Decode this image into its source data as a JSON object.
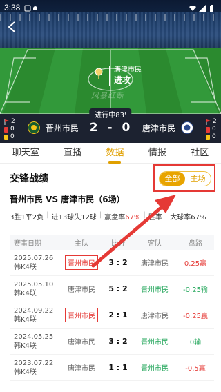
{
  "status_bar": {
    "time": "3:38"
  },
  "event": {
    "team": "唐津市民",
    "action": "进攻"
  },
  "watermark": "风暴红断",
  "scorebar": {
    "match_status": "进行中83'",
    "home": {
      "name": "晋州市民",
      "corners": "2",
      "red_cards": "0",
      "yellow_cards": "0"
    },
    "away": {
      "name": "唐津市民",
      "corners": "2",
      "red_cards": "0",
      "yellow_cards": "0"
    },
    "score_home": "2",
    "score_dash": "-",
    "score_away": "0"
  },
  "tabs": [
    {
      "label": "聊天室",
      "active": false
    },
    {
      "label": "直播",
      "active": false
    },
    {
      "label": "数据",
      "active": true
    },
    {
      "label": "情报",
      "active": false
    },
    {
      "label": "社区",
      "active": false
    }
  ],
  "section": {
    "title": "交锋战绩",
    "toggle_all": "全部",
    "toggle_home": "主场",
    "vs_title": "晋州市民 VS 唐津市民（6场）",
    "summary": {
      "record": "3胜1平2负",
      "goals": "进13球失12球",
      "win_rate_label": "赢盘率",
      "win_rate_value": "67%",
      "victory_label": "胜率",
      "victory_value": "",
      "big_ball": "大球率67%"
    }
  },
  "table": {
    "headers": {
      "date": "赛事日期",
      "home": "主队",
      "score": "比分",
      "away": "客队",
      "odds": "盘路"
    },
    "rows": [
      {
        "date": "2025.07.26",
        "league": "韩K4联",
        "home": "晋州市民",
        "score": "3 : 2",
        "away": "唐津市民",
        "odds": "0.25赢",
        "home_color": "red",
        "away_color": "grey",
        "odds_color": "red"
      },
      {
        "date": "2025.05.10",
        "league": "韩K4联",
        "home": "唐津市民",
        "score": "5 : 2",
        "away": "晋州市民",
        "odds": "-0.25输",
        "home_color": "grey",
        "away_color": "green",
        "odds_color": "green"
      },
      {
        "date": "2024.09.22",
        "league": "韩K4联",
        "home": "晋州市民",
        "score": "2 : 1",
        "away": "唐津市民",
        "odds": "-0.25赢",
        "home_color": "red",
        "away_color": "grey",
        "odds_color": "red"
      },
      {
        "date": "2024.05.25",
        "league": "韩K4联",
        "home": "唐津市民",
        "score": "3 : 2",
        "away": "晋州市民",
        "odds": "0输",
        "home_color": "grey",
        "away_color": "green",
        "odds_color": "green"
      },
      {
        "date": "2023.07.22",
        "league": "韩K4联",
        "home": "唐津市民",
        "score": "1 : 1",
        "away": "晋州市民",
        "odds": "-0.5赢",
        "home_color": "grey",
        "away_color": "green",
        "odds_color": "red"
      }
    ]
  },
  "colors": {
    "accent": "#e8a400",
    "red": "#e53935",
    "green": "#22a65a",
    "scorebar": "#1c2230"
  }
}
